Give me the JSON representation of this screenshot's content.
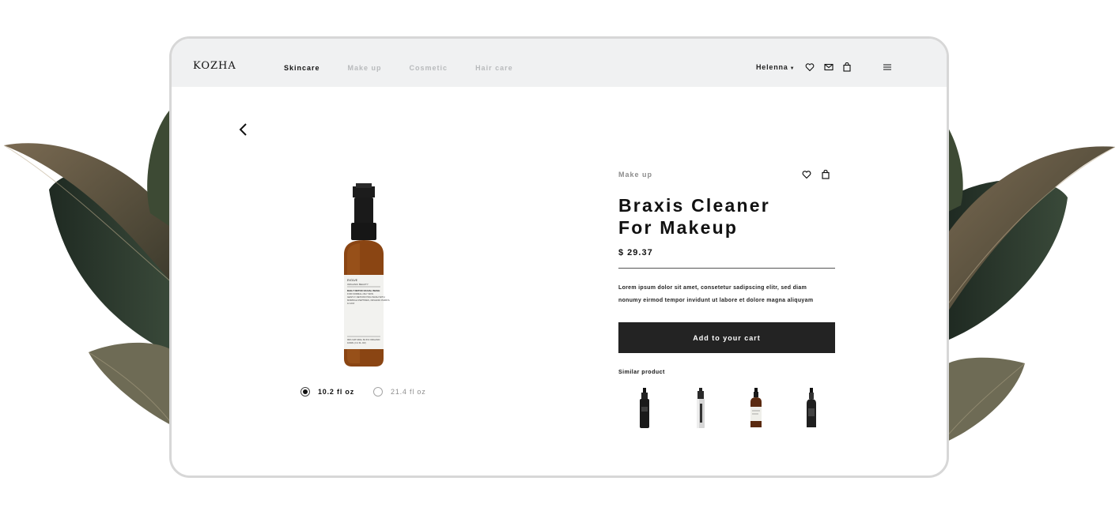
{
  "brand": {
    "logo": "KOZHA"
  },
  "nav": {
    "items": [
      {
        "label": "Skincare",
        "active": true
      },
      {
        "label": "Make up",
        "active": false
      },
      {
        "label": "Cosmetic",
        "active": false
      },
      {
        "label": "Hair care",
        "active": false
      }
    ]
  },
  "user": {
    "name": "Helenna"
  },
  "header_icons": [
    "heart-icon",
    "mail-icon",
    "bag-icon",
    "menu-icon"
  ],
  "product": {
    "category": "Make up",
    "title_line1": "Braxis Cleaner",
    "title_line2": "For Makeup",
    "price": "$ 29.37",
    "description_line1": "Lorem ipsum dolor sit amet, consetetur sadipscing elitr, sed diam",
    "description_line2": "nonumy eirmod tempor invidunt ut labore et dolore magna aliquyam",
    "cart_button": "Add to your cart",
    "bottle_label": {
      "brand": "EVOLVE",
      "sub": "ORGANIC BEAUTY",
      "name": "DAILY DETOX FACIAL WASH",
      "line1": "FOR NORMAL-OILY SKIN",
      "line2": "GENTLY DETOXIFYING WASH WITH",
      "line3": "MORINGA PEPTIDES, ORGANIC PAPAYA",
      "line4": "& GOJI",
      "bottom1": "99% NATURAL 82.6% ORGANIC",
      "bottom2": "100ML (3.4 FL.OZ)"
    }
  },
  "sizes": [
    {
      "label": "10.2 fl oz",
      "selected": true
    },
    {
      "label": "21.4 fl oz",
      "selected": false
    }
  ],
  "similar": {
    "label": "Similar product",
    "items": [
      "black-pump-bottle",
      "silver-spray-can",
      "amber-pump-bottle",
      "black-spray-bottle"
    ]
  },
  "colors": {
    "accent_dark": "#232323",
    "topbar_bg": "#f0f1f2",
    "inactive_nav": "#b8babc",
    "amber": "#8a4513"
  }
}
